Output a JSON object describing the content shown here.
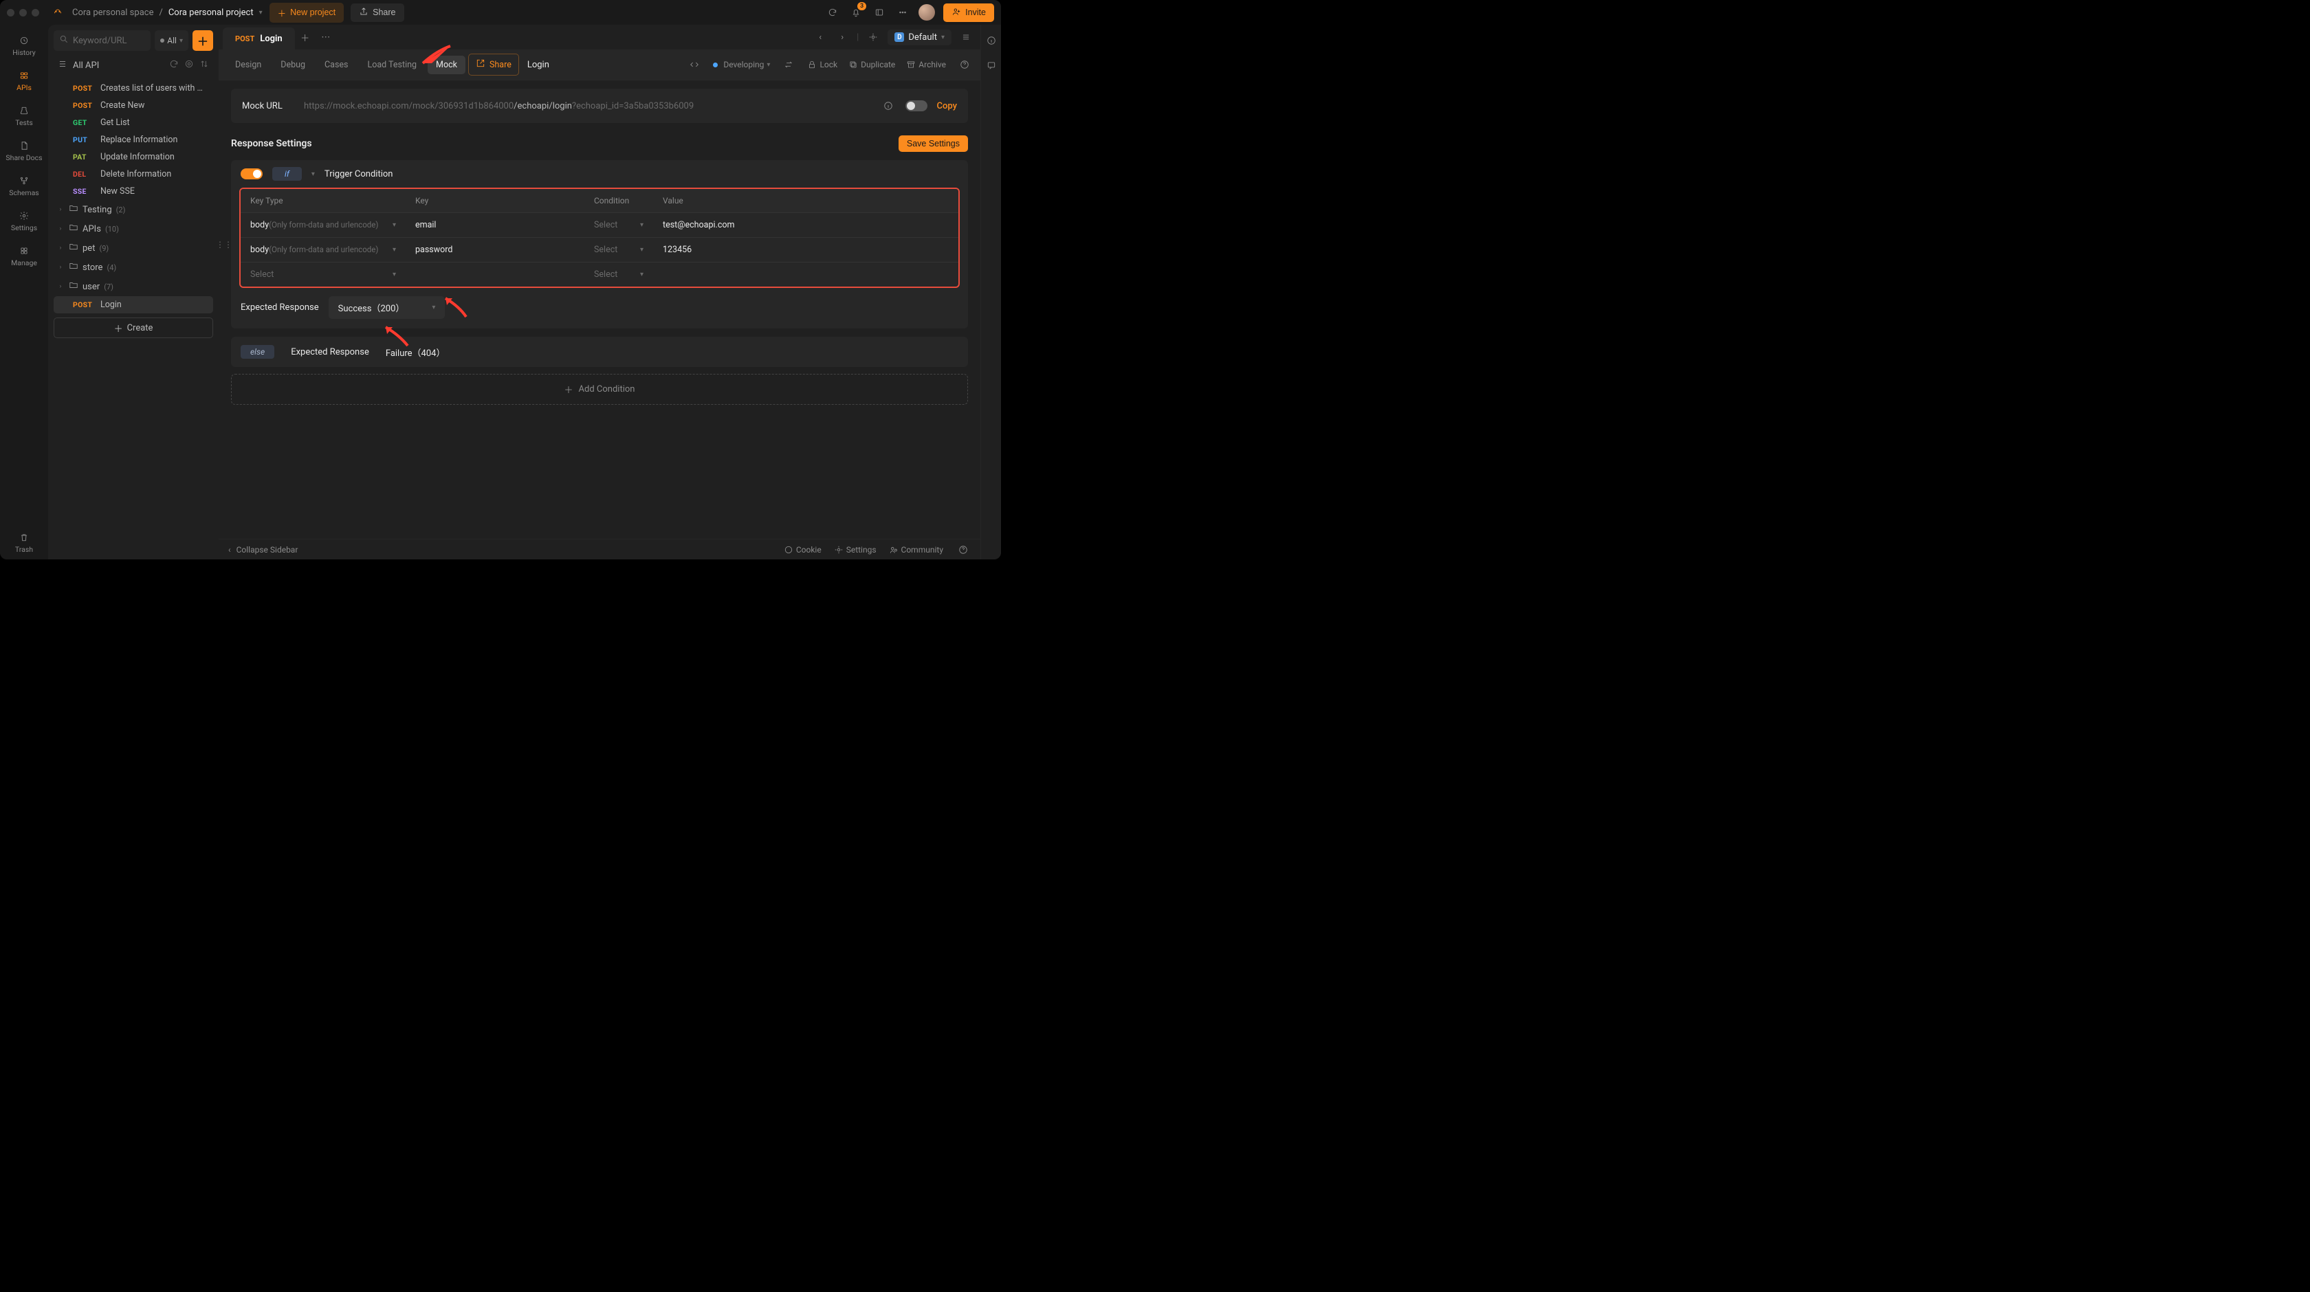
{
  "titlebar": {
    "space": "Cora personal space",
    "project": "Cora personal project",
    "new_project": "New project",
    "share": "Share",
    "notif_count": "3",
    "invite": "Invite"
  },
  "rail": {
    "history": "History",
    "apis": "APIs",
    "tests": "Tests",
    "share_docs": "Share Docs",
    "schemas": "Schemas",
    "settings": "Settings",
    "manage": "Manage",
    "trash": "Trash"
  },
  "sidebar": {
    "search_placeholder": "Keyword/URL",
    "filter_label": "All",
    "root_label": "All API",
    "create": "Create",
    "apis": [
      {
        "method": "POST",
        "mclass": "post",
        "name": "Creates list of users with …"
      },
      {
        "method": "POST",
        "mclass": "post",
        "name": "Create New"
      },
      {
        "method": "GET",
        "mclass": "get",
        "name": "Get List"
      },
      {
        "method": "PUT",
        "mclass": "put",
        "name": "Replace Information"
      },
      {
        "method": "PAT",
        "mclass": "pat",
        "name": "Update Information"
      },
      {
        "method": "DEL",
        "mclass": "del",
        "name": "Delete Information"
      },
      {
        "method": "SSE",
        "mclass": "sse",
        "name": "New SSE"
      }
    ],
    "folders": [
      {
        "name": "Testing",
        "count": "(2)"
      },
      {
        "name": "APIs",
        "count": "(10)"
      },
      {
        "name": "pet",
        "count": "(9)"
      },
      {
        "name": "store",
        "count": "(4)"
      },
      {
        "name": "user",
        "count": "(7)"
      }
    ],
    "selected": {
      "method": "POST",
      "mclass": "post",
      "name": "Login"
    }
  },
  "tabs": {
    "login_method": "POST",
    "login_name": "Login",
    "subtabs": {
      "design": "Design",
      "debug": "Debug",
      "cases": "Cases",
      "load": "Load Testing",
      "mock": "Mock",
      "share": "Share"
    },
    "breadcrumb": "Login",
    "status": "Developing",
    "lock": "Lock",
    "duplicate": "Duplicate",
    "archive": "Archive",
    "env": "Default"
  },
  "mock": {
    "url_label": "Mock URL",
    "url_pre": "https://mock.echoapi.com/mock/306931d1b864000",
    "url_mid": "/echoapi/login",
    "url_suf": "?echoapi_id=3a5ba0353b6009",
    "copy": "Copy"
  },
  "response": {
    "section_title": "Response Settings",
    "save": "Save Settings",
    "if_label": "if",
    "trigger": "Trigger Condition",
    "headers": {
      "keytype": "Key Type",
      "key": "Key",
      "cond": "Condition",
      "value": "Value"
    },
    "rows": [
      {
        "kt": "body",
        "hint": "(Only form-data and urlencode)",
        "key": "email",
        "cond": "Select",
        "value": "test@echoapi.com"
      },
      {
        "kt": "body",
        "hint": "(Only form-data and urlencode)",
        "key": "password",
        "cond": "Select",
        "value": "123456"
      },
      {
        "kt": "Select",
        "hint": "",
        "key": "",
        "cond": "Select",
        "value": ""
      }
    ],
    "expected_label": "Expected Response",
    "expected_value": "Success（200）",
    "else_label": "else",
    "else_expected": "Expected Response",
    "else_value": "Failure（404）",
    "add_cond": "Add Condition"
  },
  "footer": {
    "collapse": "Collapse Sidebar",
    "cookie": "Cookie",
    "settings": "Settings",
    "community": "Community"
  }
}
